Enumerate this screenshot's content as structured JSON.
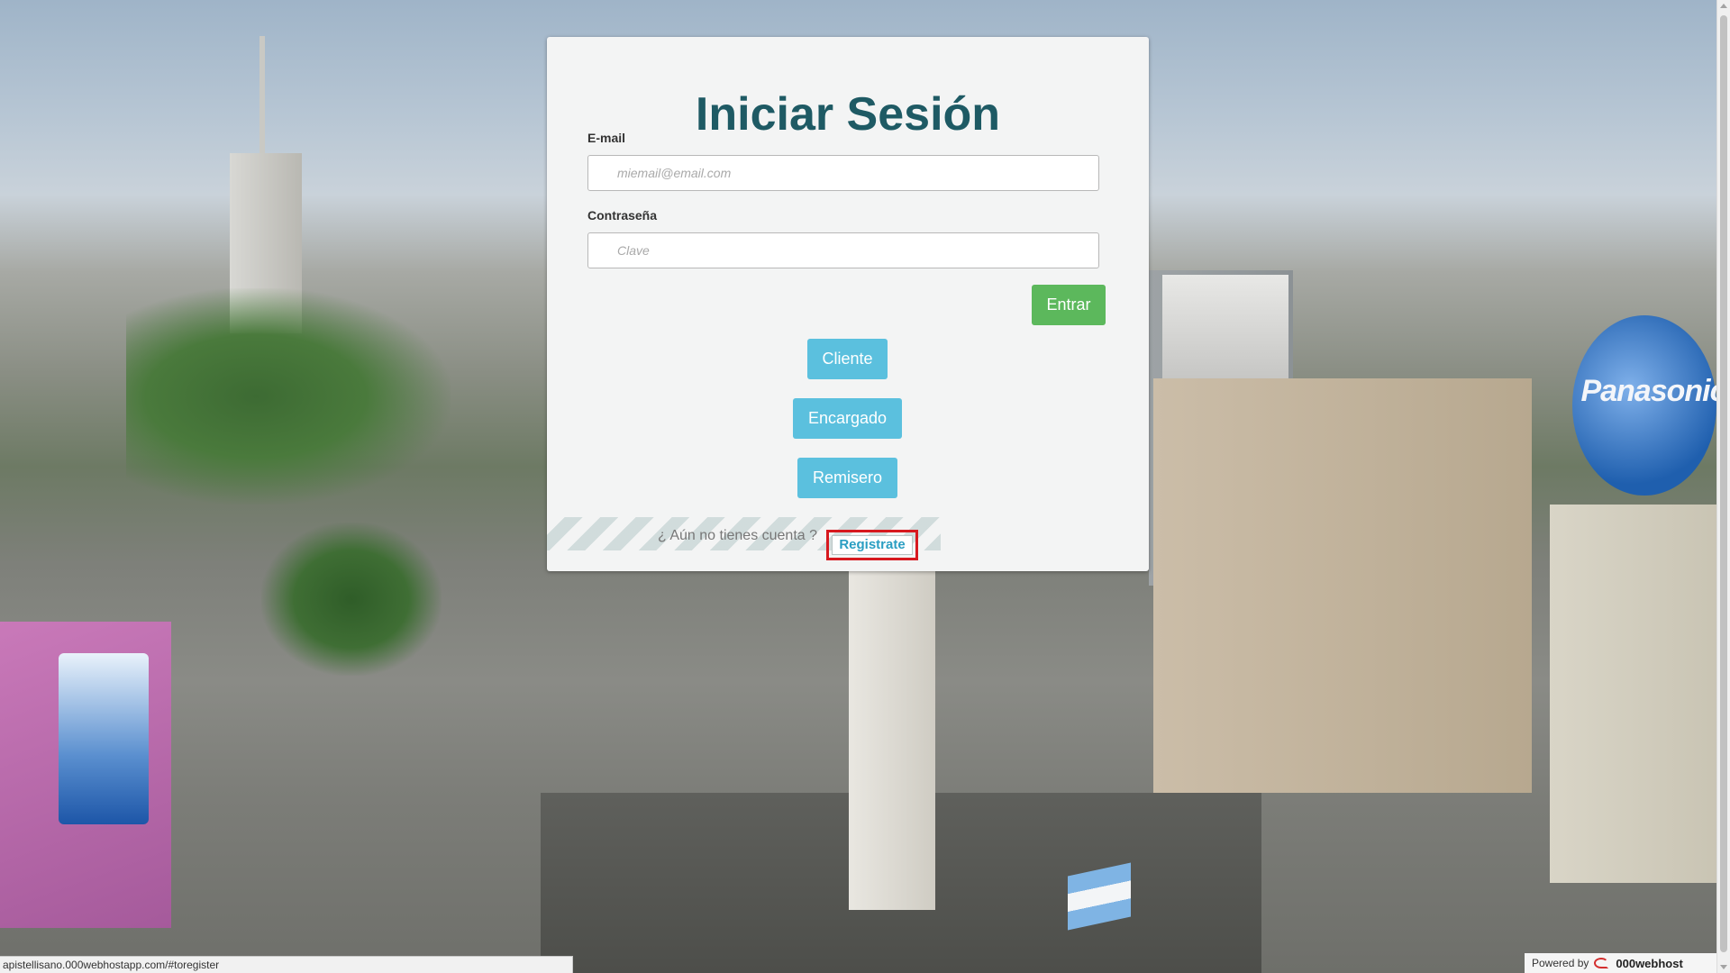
{
  "login": {
    "title": "Iniciar Sesión",
    "email_label": "E-mail",
    "email_placeholder": "miemail@email.com",
    "password_label": "Contraseña",
    "password_placeholder": "Clave",
    "submit_label": "Entrar",
    "roles": [
      {
        "label": "Cliente"
      },
      {
        "label": "Encargado"
      },
      {
        "label": "Remisero"
      }
    ],
    "register_prompt": "¿ Aún no tienes cuenta ?",
    "register_label": "Registrate"
  },
  "status_bar": {
    "url": "apistellisano.000webhostapp.com/#toregister"
  },
  "powered_by": {
    "prefix": "Powered by",
    "brand": "000webhost"
  },
  "background": {
    "billboard_text": "Panasonic"
  },
  "colors": {
    "title": "#1e5a64",
    "success_button": "#5cb85c",
    "info_button": "#5bc0de",
    "register_link": "#2a9ec2",
    "highlight": "#d7191f"
  }
}
